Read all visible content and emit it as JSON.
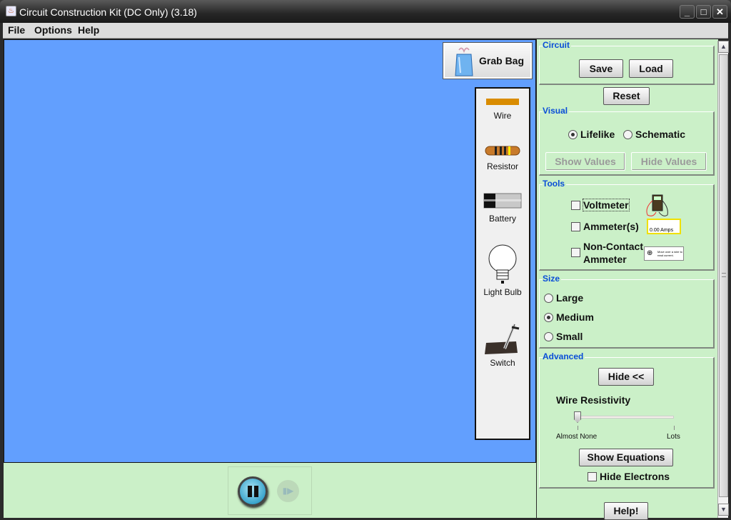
{
  "window": {
    "title": "Circuit Construction Kit (DC Only) (3.18)",
    "controls": {
      "minimize": "_",
      "maximize": "□",
      "close": "✕"
    }
  },
  "menu": [
    "File",
    "Options",
    "Help"
  ],
  "canvas": {
    "grab_bag": "Grab Bag",
    "toolbox": [
      {
        "label": "Wire",
        "icon": "wire-icon"
      },
      {
        "label": "Resistor",
        "icon": "resistor-icon"
      },
      {
        "label": "Battery",
        "icon": "battery-icon"
      },
      {
        "label": "Light Bulb",
        "icon": "light-bulb-icon"
      },
      {
        "label": "Switch",
        "icon": "switch-icon"
      }
    ]
  },
  "clock": {
    "pause": "pause",
    "step": "step"
  },
  "panel": {
    "circuit": {
      "title": "Circuit",
      "save": "Save",
      "load": "Load",
      "reset": "Reset"
    },
    "visual": {
      "title": "Visual",
      "lifelike": "Lifelike",
      "schematic": "Schematic",
      "selected": "Lifelike",
      "show_values": "Show Values",
      "hide_values": "Hide Values"
    },
    "tools": {
      "title": "Tools",
      "voltmeter": "Voltmeter",
      "ammeter": "Ammeter(s)",
      "noncontact_1": "Non-Contact",
      "noncontact_2": "Ammeter",
      "ammeter_readout": "0.00 Amps",
      "noncontact_hint": "Move over a wire to read current."
    },
    "size": {
      "title": "Size",
      "large": "Large",
      "medium": "Medium",
      "small": "Small",
      "selected": "Medium"
    },
    "advanced": {
      "title": "Advanced",
      "hide": "Hide <<",
      "resistivity_label": "Wire Resistivity",
      "min_label": "Almost None",
      "max_label": "Lots",
      "resistivity_value": 0.0,
      "show_equations": "Show Equations",
      "hide_electrons": "Hide Electrons"
    },
    "help": "Help!"
  }
}
